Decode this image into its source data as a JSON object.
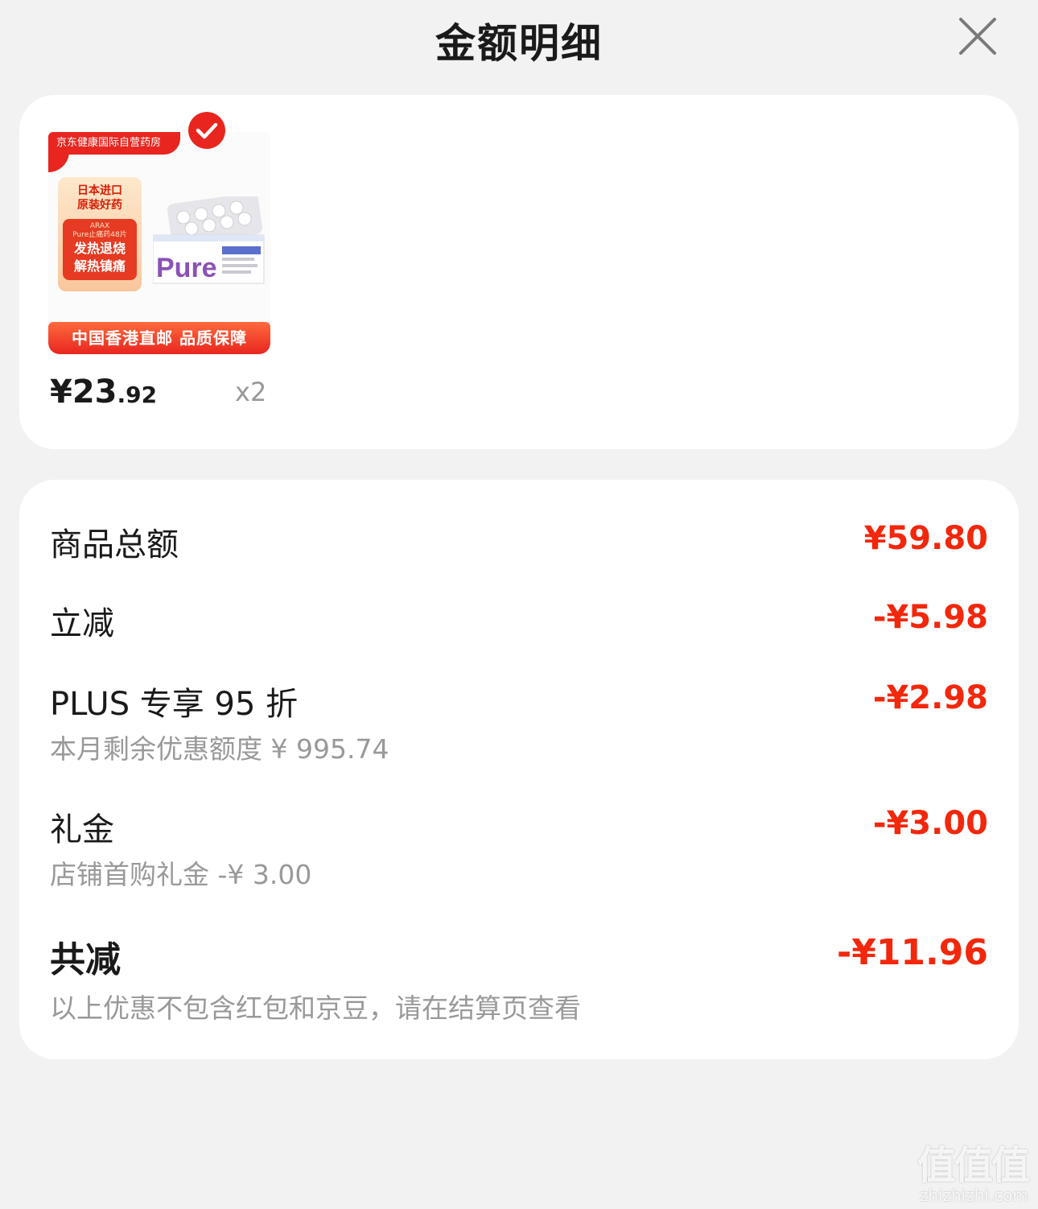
{
  "header": {
    "title": "金额明细"
  },
  "product": {
    "thumbnail": {
      "top_banner": "京东健康国际自营药房",
      "badge_line1": "日本进口",
      "badge_line2": "原装好药",
      "badge_brand": "ARAX",
      "badge_name": "Pure止痛药48片",
      "badge_big1": "发热退烧",
      "badge_big2": "解热镇痛",
      "bottom_bar": "中国香港直邮 品质保障"
    },
    "selected": true,
    "price_symbol": "¥",
    "price_int": "23",
    "price_dec": ".92",
    "quantity": "x2"
  },
  "summary": {
    "rows": [
      {
        "label": "商品总额",
        "value": "¥59.80"
      },
      {
        "label": "立减",
        "value": "-¥5.98"
      },
      {
        "label": "PLUS 专享 95 折",
        "value": "-¥2.98",
        "sub": "本月剩余优惠额度 ¥ 995.74"
      },
      {
        "label": "礼金",
        "value": "-¥3.00",
        "sub": "店铺首购礼金 -¥ 3.00"
      }
    ],
    "total": {
      "label": "共减",
      "value": "-¥11.96",
      "note": "以上优惠不包含红包和京豆，请在结算页查看"
    }
  },
  "watermark": {
    "logo": "值值值",
    "domain": "zhizhizhi.com"
  },
  "colors": {
    "accent": "#f2270c",
    "muted": "#999999",
    "background": "#f2f2f2"
  }
}
